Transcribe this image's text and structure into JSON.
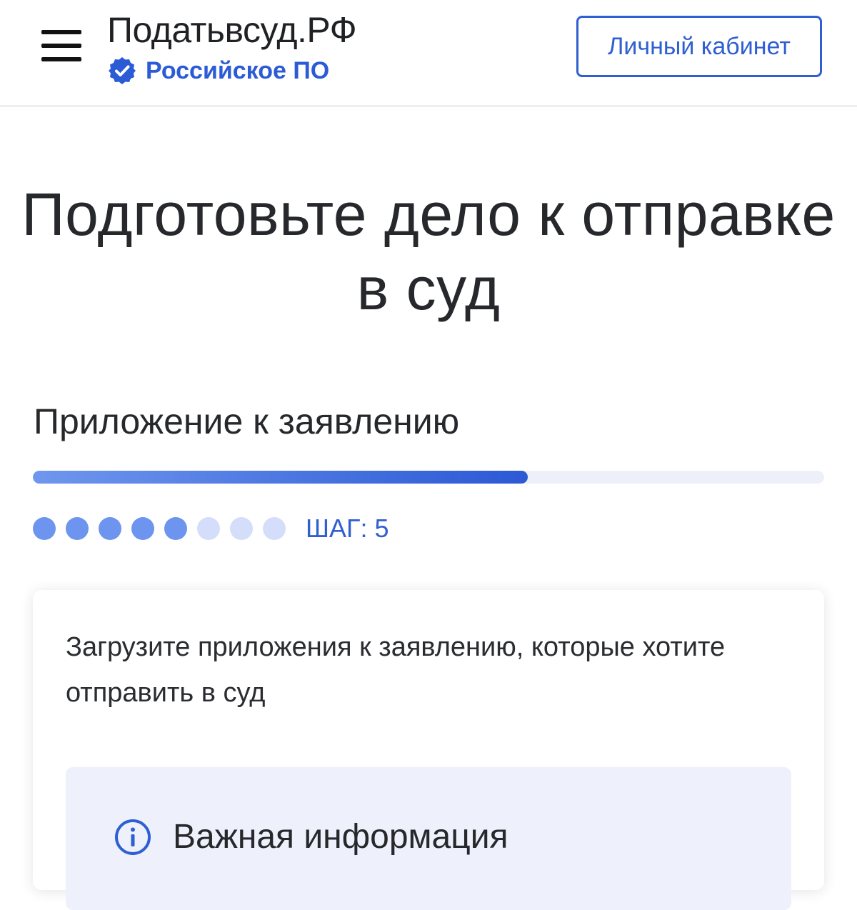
{
  "header": {
    "brand_name": "Податьвсуд.РФ",
    "brand_badge": "Российское ПО",
    "cabinet_label": "Личный кабинет"
  },
  "page": {
    "title": "Подготовьте дело к отправке в суд",
    "section_title": "Приложение к заявлению"
  },
  "progress": {
    "fraction": 0.625,
    "total_steps": 8,
    "current_step": 5,
    "step_label": "ШАГ: 5"
  },
  "card": {
    "text": "Загрузите приложения к заявлению, которые хотите отправить в суд",
    "info_title": "Важная информация"
  },
  "colors": {
    "accent": "#2f5fd0",
    "dot_active": "#6d94ee",
    "dot_inactive": "#d4defa",
    "info_bg": "#eef1fb"
  },
  "icons": {
    "menu": "hamburger-icon",
    "badge": "verified-badge-icon",
    "info": "info-circle-icon"
  }
}
